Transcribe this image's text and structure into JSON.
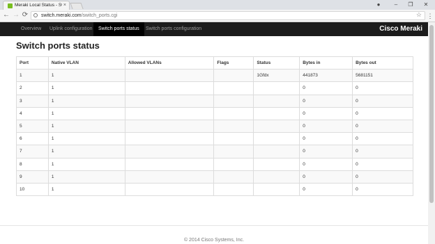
{
  "browser": {
    "tab_title": "Meraki Local Status - Swi",
    "tab_close": "×",
    "url_host": "switch.meraki.com",
    "url_path": "/switch_ports.cgi",
    "back_glyph": "←",
    "forward_glyph": "→",
    "reload_glyph": "⟳",
    "star_glyph": "☆",
    "menu_glyph": "⋮",
    "account_glyph": "●",
    "minimize_glyph": "–",
    "maximize_glyph": "❐",
    "close_glyph": "✕"
  },
  "navbar": {
    "items": [
      {
        "label": "Overview",
        "active": false
      },
      {
        "label": "Uplink configuration",
        "active": false
      },
      {
        "label": "Switch ports status",
        "active": true
      },
      {
        "label": "Switch ports configuration",
        "active": false
      }
    ],
    "brand": "Cisco Meraki"
  },
  "page": {
    "title": "Switch ports status"
  },
  "table": {
    "headers": [
      "Port",
      "Native VLAN",
      "Allowed VLANs",
      "Flags",
      "Status",
      "Bytes in",
      "Bytes out"
    ],
    "rows": [
      [
        "1",
        "1",
        "",
        "",
        "1Gfdx",
        "441873",
        "5681151"
      ],
      [
        "2",
        "1",
        "",
        "",
        "",
        "0",
        "0"
      ],
      [
        "3",
        "1",
        "",
        "",
        "",
        "0",
        "0"
      ],
      [
        "4",
        "1",
        "",
        "",
        "",
        "0",
        "0"
      ],
      [
        "5",
        "1",
        "",
        "",
        "",
        "0",
        "0"
      ],
      [
        "6",
        "1",
        "",
        "",
        "",
        "0",
        "0"
      ],
      [
        "7",
        "1",
        "",
        "",
        "",
        "0",
        "0"
      ],
      [
        "8",
        "1",
        "",
        "",
        "",
        "0",
        "0"
      ],
      [
        "9",
        "1",
        "",
        "",
        "",
        "0",
        "0"
      ],
      [
        "10",
        "1",
        "",
        "",
        "",
        "0",
        "0"
      ]
    ]
  },
  "footer": {
    "copyright": "© 2014 Cisco Systems, Inc."
  },
  "colors": {
    "navbar_bg": "#1c1c1c",
    "active_nav_bg": "#000000",
    "favicon": "#78be20"
  }
}
